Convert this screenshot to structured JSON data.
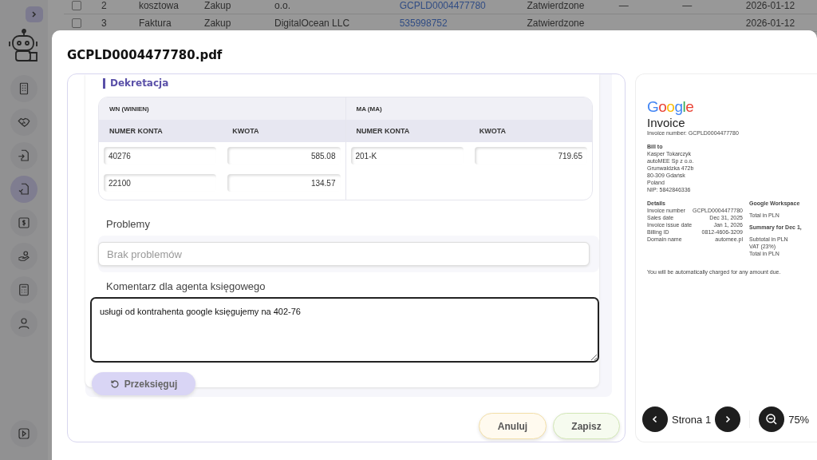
{
  "sidebar": {
    "items": [
      {
        "kind": "building",
        "selected": false
      },
      {
        "kind": "handshake",
        "selected": false
      },
      {
        "kind": "file-in",
        "selected": false
      },
      {
        "kind": "file-check",
        "selected": true
      },
      {
        "kind": "dollar",
        "selected": false
      },
      {
        "kind": "hand-coin",
        "selected": false
      },
      {
        "kind": "calculator",
        "selected": false
      },
      {
        "kind": "user",
        "selected": false
      }
    ]
  },
  "background_table": {
    "rows": [
      {
        "checked": false,
        "cells": [
          "2",
          "kosztowa",
          "Zakup",
          "o.o.",
          "GCPLD0004477780",
          "Zatwierdzone",
          "—",
          "—",
          "2026-01-12"
        ]
      },
      {
        "checked": false,
        "cells": [
          "3",
          "Faktura",
          "Zakup",
          "DigitalOcean LLC",
          "535998752",
          "Zatwierdzone",
          "",
          "",
          "2026-01-12"
        ]
      }
    ]
  },
  "modal": {
    "title": "GCPLD0004477780.pdf",
    "section_title": "Dekretacja",
    "sides": [
      {
        "title": "WN (WINIEN)",
        "columns": [
          "NUMER KONTA",
          "KWOTA"
        ],
        "rows": [
          {
            "account": "40276",
            "amount": "585.08"
          },
          {
            "account": "22100",
            "amount": "134.57"
          }
        ]
      },
      {
        "title": "MA (MA)",
        "columns": [
          "NUMER KONTA",
          "KWOTA"
        ],
        "rows": [
          {
            "account": "201-K",
            "amount": "719.65"
          }
        ]
      }
    ],
    "problems": {
      "label": "Problemy",
      "placeholder": "Brak problemów"
    },
    "comment": {
      "label": "Komentarz dla agenta księgowego",
      "value": "usługi od kontrahenta google księgujemy na 402-76"
    },
    "repost_button": "Przeksięguj",
    "buttons": [
      {
        "kind": "cancel",
        "label": "Anuluj"
      },
      {
        "kind": "save",
        "label": "Zapisz"
      }
    ]
  },
  "preview": {
    "logo": "Google",
    "heading": "Invoice",
    "invoice_number": "Invoice number: GCPLD0004477780",
    "bill_to_title": "Bill to",
    "bill_to": [
      "Kasper Tokarczyk",
      "autoMEE Sp z o.o.",
      "Grunwaldzka 472b",
      "80-309 Gdańsk",
      "Poland",
      "NIP: 5842846336"
    ],
    "details_title": "Details",
    "details": [
      {
        "label": "Invoice number",
        "value": "GCPLD0004477780"
      },
      {
        "label": "Sales date",
        "value": "Dec 31, 2025"
      },
      {
        "label": "Invoice issue date",
        "value": "Jan 1, 2026"
      },
      {
        "label": "Billing ID",
        "value": "0812-4606-3209"
      },
      {
        "label": "Domain name",
        "value": "automee.pl"
      }
    ],
    "side_title": "Google Workspace",
    "side_total": "Total in PLN",
    "summary_title": "Summary for Dec 1,",
    "summary": [
      "Subtotal in PLN",
      "VAT (23%)",
      "Total in PLN"
    ],
    "footer": "You will be automatically charged for any amount due.",
    "page_label": "Strona 1",
    "zoom": "75%"
  }
}
